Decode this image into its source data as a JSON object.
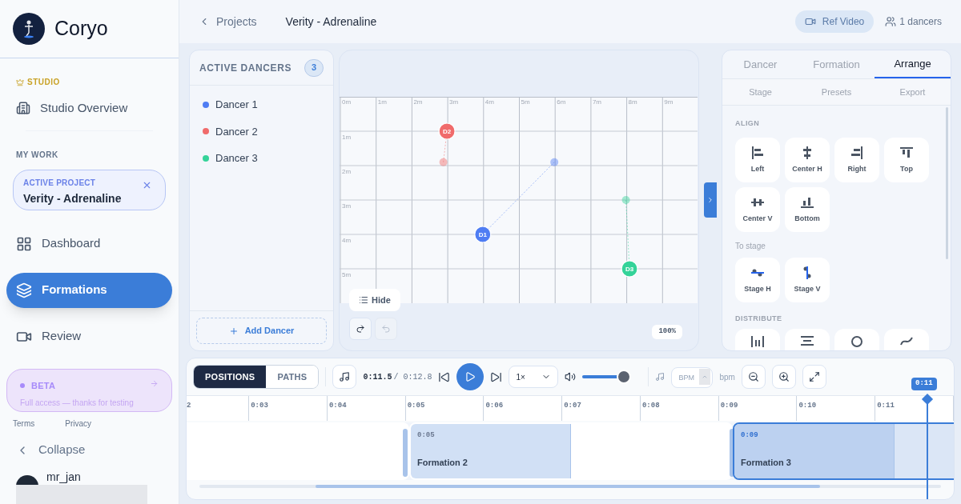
{
  "brand": {
    "name": "Coryo"
  },
  "sidebar": {
    "studio_label": "STUDIO",
    "studio_items": [
      {
        "label": "Studio Overview",
        "selected": false
      }
    ],
    "my_work_label": "MY WORK",
    "active_project": {
      "label": "ACTIVE PROJECT",
      "name": "Verity - Adrenaline"
    },
    "items": [
      {
        "label": "Dashboard",
        "selected": false
      },
      {
        "label": "Formations",
        "selected": true
      },
      {
        "label": "Review",
        "selected": false
      }
    ],
    "beta": {
      "label": "BETA",
      "text": "Full access — thanks for testing"
    },
    "links": [
      "Terms",
      "Privacy"
    ],
    "collapse": "Collapse",
    "user": {
      "name": "mr_jan"
    }
  },
  "header": {
    "back": "Projects",
    "title": "Verity - Adrenaline",
    "ref_video": "Ref Video",
    "dancers": "1 dancers"
  },
  "dancers_panel": {
    "title": "ACTIVE DANCERS",
    "count": "3",
    "dancers": [
      {
        "name": "Dancer 1",
        "color": "#4f7df3"
      },
      {
        "name": "Dancer 2",
        "color": "#f06b6b"
      },
      {
        "name": "Dancer 3",
        "color": "#34d399"
      }
    ],
    "add_button": "Add Dancer"
  },
  "stage": {
    "x_labels": [
      "0m",
      "1m",
      "2m",
      "3m",
      "4m",
      "5m",
      "6m",
      "7m",
      "8m",
      "9m"
    ],
    "y_labels": [
      "1m",
      "2m",
      "3m",
      "4m",
      "5m"
    ],
    "markers": [
      {
        "label": "D2",
        "color": "#f06b6b"
      },
      {
        "label": "D1",
        "color": "#4f7df3"
      },
      {
        "label": "D3",
        "color": "#34d399"
      }
    ],
    "hide_button": "Hide",
    "redo_disabled": false,
    "undo_disabled": true,
    "zoom": "100%"
  },
  "inspector": {
    "tabs": [
      {
        "label": "Dancer",
        "selected": false
      },
      {
        "label": "Formation",
        "selected": false
      },
      {
        "label": "Arrange",
        "selected": true
      }
    ],
    "subtabs": [
      "Stage",
      "Presets",
      "Export"
    ],
    "align_title": "ALIGN",
    "align": [
      "Left",
      "Center H",
      "Right",
      "Top",
      "Center V",
      "Bottom"
    ],
    "to_stage_title": "To stage",
    "to_stage": [
      "Stage H",
      "Stage V"
    ],
    "distribute_title": "DISTRIBUTE"
  },
  "timeline": {
    "modes": [
      {
        "label": "POSITIONS",
        "selected": true
      },
      {
        "label": "PATHS",
        "selected": false
      }
    ],
    "current_time": "0:11.5",
    "total_time": "/ 0:12.8",
    "playing": false,
    "speed": "1×",
    "volume": {
      "level": 0.9
    },
    "bpm_placeholder": "BPM",
    "bpm_unit": "bpm",
    "ruler": [
      "2",
      "0:03",
      "0:04",
      "0:05",
      "0:06",
      "0:07",
      "0:08",
      "0:09",
      "0:10",
      "0:11"
    ],
    "playhead": "0:11",
    "clips": [
      {
        "label": "Formation 2",
        "start": "0:05",
        "selected": false
      },
      {
        "label": "Formation 3",
        "start": "0:09",
        "selected": true
      }
    ]
  }
}
